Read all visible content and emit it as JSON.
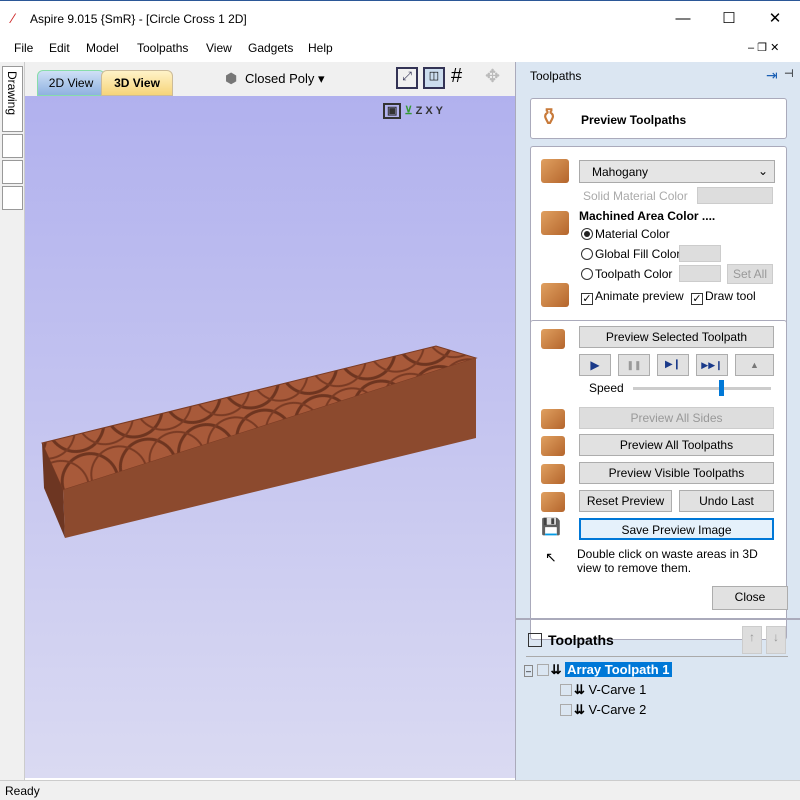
{
  "window": {
    "title": "Aspire 9.015 {SmR} - [Circle Cross 1 2D]",
    "minimize": "—",
    "maximize": "☐",
    "close": "✕"
  },
  "menu": [
    "File",
    "Edit",
    "Model",
    "Toolpaths",
    "View",
    "Gadgets",
    "Help"
  ],
  "side_tabs": [
    "Drawing"
  ],
  "view_tabs": {
    "tab_2d": "2D View",
    "tab_3d": "3D View",
    "active": "3D View"
  },
  "toolbar": {
    "draw_mode": "Closed Poly ▾"
  },
  "view_axes": [
    "Z",
    "X",
    "Y"
  ],
  "panel": {
    "title": "Toolpaths",
    "header": "Preview Toolpaths",
    "material": {
      "selected": "Mahogany",
      "solid_color_label": "Solid Material Color"
    },
    "machined": {
      "heading": "Machined Area Color ....",
      "options": [
        "Material Color",
        "Global Fill Color",
        "Toolpath Color"
      ],
      "selected": "Material Color",
      "set_all": "Set All"
    },
    "animate_preview": {
      "label": "Animate preview",
      "checked": true
    },
    "draw_tool": {
      "label": "Draw tool",
      "checked": true
    },
    "buttons": {
      "preview_selected": "Preview Selected Toolpath",
      "preview_all_sides": "Preview All Sides",
      "preview_all": "Preview All Toolpaths",
      "preview_visible": "Preview Visible Toolpaths",
      "reset": "Reset Preview",
      "undo": "Undo Last",
      "save_image": "Save Preview Image",
      "close": "Close"
    },
    "playback": [
      "▶",
      "❚❚",
      "▶❙",
      "▶▶❙",
      "▲"
    ],
    "speed": {
      "label": "Speed",
      "value": 0.65
    },
    "hint": "Double click on waste areas in 3D view to remove them."
  },
  "toolpaths_list": {
    "title": "Toolpaths",
    "items": [
      {
        "name": "Array Toolpath 1",
        "selected": true,
        "level": 0
      },
      {
        "name": "V-Carve 1",
        "level": 1
      },
      {
        "name": "V-Carve 2",
        "level": 1
      }
    ]
  },
  "status": "Ready",
  "colors": {
    "accent": "#0078d7",
    "material": "#b4652c",
    "viewport": "#b1b1ee"
  }
}
